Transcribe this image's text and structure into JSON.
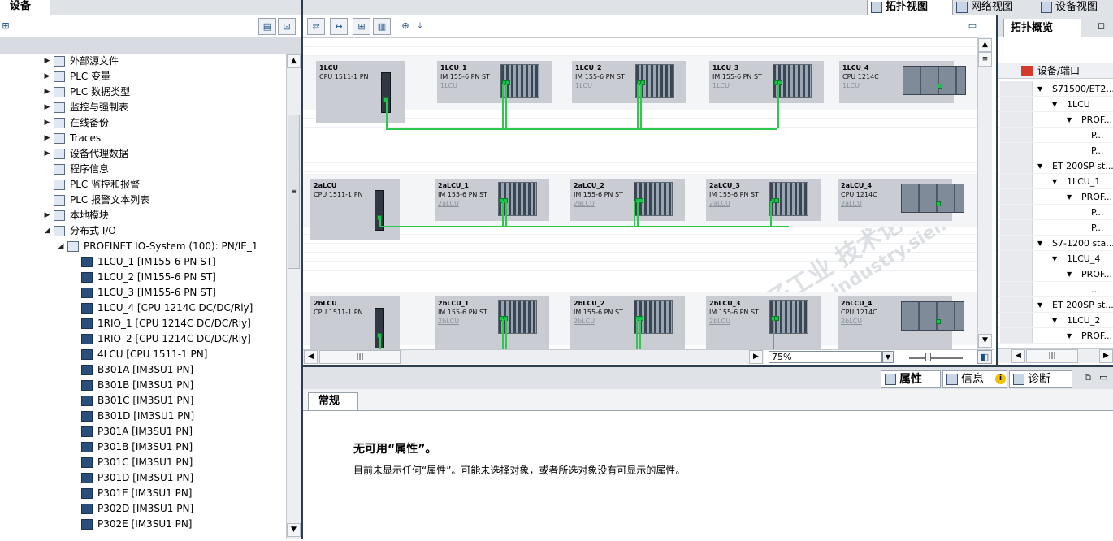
{
  "left": {
    "tab": "设备",
    "tree": [
      {
        "label": "外部源文件",
        "indent": 0,
        "expand": "collapsed"
      },
      {
        "label": "PLC 变量",
        "indent": 0,
        "expand": "collapsed"
      },
      {
        "label": "PLC 数据类型",
        "indent": 0,
        "expand": "collapsed"
      },
      {
        "label": "监控与强制表",
        "indent": 0,
        "expand": "collapsed"
      },
      {
        "label": "在线备份",
        "indent": 0,
        "expand": "collapsed"
      },
      {
        "label": "Traces",
        "indent": 0,
        "expand": "collapsed"
      },
      {
        "label": "设备代理数据",
        "indent": 0,
        "expand": "collapsed"
      },
      {
        "label": "程序信息",
        "indent": 0,
        "expand": "none"
      },
      {
        "label": "PLC 监控和报警",
        "indent": 0,
        "expand": "none"
      },
      {
        "label": "PLC 报警文本列表",
        "indent": 0,
        "expand": "none"
      },
      {
        "label": "本地模块",
        "indent": 0,
        "expand": "collapsed"
      },
      {
        "label": "分布式 I/O",
        "indent": 0,
        "expand": "expanded"
      },
      {
        "label": "PROFINET IO-System (100): PN/IE_1",
        "indent": 1,
        "expand": "expanded"
      },
      {
        "label": "1LCU_1 [IM155-6 PN ST]",
        "indent": 2,
        "expand": "none"
      },
      {
        "label": "1LCU_2 [IM155-6 PN ST]",
        "indent": 2,
        "expand": "none"
      },
      {
        "label": "1LCU_3 [IM155-6 PN ST]",
        "indent": 2,
        "expand": "none"
      },
      {
        "label": "1LCU_4 [CPU 1214C DC/DC/Rly]",
        "indent": 2,
        "expand": "none"
      },
      {
        "label": "1RIO_1 [CPU 1214C DC/DC/Rly]",
        "indent": 2,
        "expand": "none"
      },
      {
        "label": "1RIO_2 [CPU 1214C DC/DC/Rly]",
        "indent": 2,
        "expand": "none"
      },
      {
        "label": "4LCU [CPU 1511-1 PN]",
        "indent": 2,
        "expand": "none"
      },
      {
        "label": "B301A [IM3SU1 PN]",
        "indent": 2,
        "expand": "none"
      },
      {
        "label": "B301B [IM3SU1 PN]",
        "indent": 2,
        "expand": "none"
      },
      {
        "label": "B301C [IM3SU1 PN]",
        "indent": 2,
        "expand": "none"
      },
      {
        "label": "B301D [IM3SU1 PN]",
        "indent": 2,
        "expand": "none"
      },
      {
        "label": "P301A [IM3SU1 PN]",
        "indent": 2,
        "expand": "none"
      },
      {
        "label": "P301B [IM3SU1 PN]",
        "indent": 2,
        "expand": "none"
      },
      {
        "label": "P301C [IM3SU1 PN]",
        "indent": 2,
        "expand": "none"
      },
      {
        "label": "P301D [IM3SU1 PN]",
        "indent": 2,
        "expand": "none"
      },
      {
        "label": "P301E [IM3SU1 PN]",
        "indent": 2,
        "expand": "none"
      },
      {
        "label": "P302D [IM3SU1 PN]",
        "indent": 2,
        "expand": "none"
      },
      {
        "label": "P302E [IM3SU1 PN]",
        "indent": 2,
        "expand": "none"
      }
    ]
  },
  "view_tabs": {
    "topology": "拓扑视图",
    "network": "网络视图",
    "device": "设备视图"
  },
  "canvas": {
    "zoom": "75%",
    "rows": [
      {
        "cpu": {
          "name": "1LCU",
          "type": "CPU 1511-1 PN"
        },
        "devices": [
          {
            "name": "1LCU_1",
            "type": "IM 155-6 PN ST",
            "sub": "1LCU",
            "kind": "im"
          },
          {
            "name": "1LCU_2",
            "type": "IM 155-6 PN ST",
            "sub": "1LCU",
            "kind": "im"
          },
          {
            "name": "1LCU_3",
            "type": "IM 155-6 PN ST",
            "sub": "1LCU",
            "kind": "im"
          },
          {
            "name": "1LCU_4",
            "type": "CPU 1214C",
            "sub": "1LCU",
            "kind": "s1200"
          }
        ]
      },
      {
        "cpu": {
          "name": "2aLCU",
          "type": "CPU 1511-1 PN"
        },
        "devices": [
          {
            "name": "2aLCU_1",
            "type": "IM 155-6 PN ST",
            "sub": "2aLCU",
            "kind": "im"
          },
          {
            "name": "2aLCU_2",
            "type": "IM 155-6 PN ST",
            "sub": "2aLCU",
            "kind": "im"
          },
          {
            "name": "2aLCU_3",
            "type": "IM 155-6 PN ST",
            "sub": "2aLCU",
            "kind": "im"
          },
          {
            "name": "2aLCU_4",
            "type": "CPU 1214C",
            "sub": "2aLCU",
            "kind": "s1200"
          }
        ]
      },
      {
        "cpu": {
          "name": "2bLCU",
          "type": "CPU 1511-1 PN"
        },
        "devices": [
          {
            "name": "2bLCU_1",
            "type": "IM 155-6 PN ST",
            "sub": "2bLCU",
            "kind": "im"
          },
          {
            "name": "2bLCU_2",
            "type": "IM 155-6 PN ST",
            "sub": "2bLCU",
            "kind": "im"
          },
          {
            "name": "2bLCU_3",
            "type": "IM 155-6 PN ST",
            "sub": "2bLCU",
            "kind": "im"
          },
          {
            "name": "2bLCU_4",
            "type": "CPU 1214C",
            "sub": "2bLCU",
            "kind": "s1200"
          }
        ]
      }
    ]
  },
  "overview": {
    "tab": "拓扑概览",
    "header": "设备/端口",
    "rows": [
      {
        "label": "S71500/ET2...",
        "indent": 0,
        "expand": "expanded"
      },
      {
        "label": "1LCU",
        "indent": 1,
        "expand": "expanded"
      },
      {
        "label": "PROF...",
        "indent": 2,
        "expand": "expanded"
      },
      {
        "label": "P...",
        "indent": 3,
        "expand": "none"
      },
      {
        "label": "P...",
        "indent": 3,
        "expand": "none"
      },
      {
        "label": "ET 200SP st...",
        "indent": 0,
        "expand": "expanded"
      },
      {
        "label": "1LCU_1",
        "indent": 1,
        "expand": "expanded"
      },
      {
        "label": "PROF...",
        "indent": 2,
        "expand": "expanded"
      },
      {
        "label": "P...",
        "indent": 3,
        "expand": "none"
      },
      {
        "label": "P...",
        "indent": 3,
        "expand": "none"
      },
      {
        "label": "S7-1200 sta...",
        "indent": 0,
        "expand": "expanded"
      },
      {
        "label": "1LCU_4",
        "indent": 1,
        "expand": "expanded"
      },
      {
        "label": "PROF...",
        "indent": 2,
        "expand": "expanded"
      },
      {
        "label": "...",
        "indent": 3,
        "expand": "none"
      },
      {
        "label": "ET 200SP st...",
        "indent": 0,
        "expand": "expanded"
      },
      {
        "label": "1LCU_2",
        "indent": 1,
        "expand": "expanded"
      },
      {
        "label": "PROF...",
        "indent": 2,
        "expand": "expanded"
      }
    ]
  },
  "props": {
    "tabs": {
      "properties": "属性",
      "info": "信息",
      "diagnostics": "诊断"
    },
    "subtab": "常规",
    "title": "无可用“属性”。",
    "message": "目前未显示任何“属性”。可能未选择对象，或者所选对象没有可显示的属性。"
  },
  "watermark": {
    "line1": "西门子工业 技术论坛",
    "line2": "support.industry.siemens.com/cs"
  }
}
